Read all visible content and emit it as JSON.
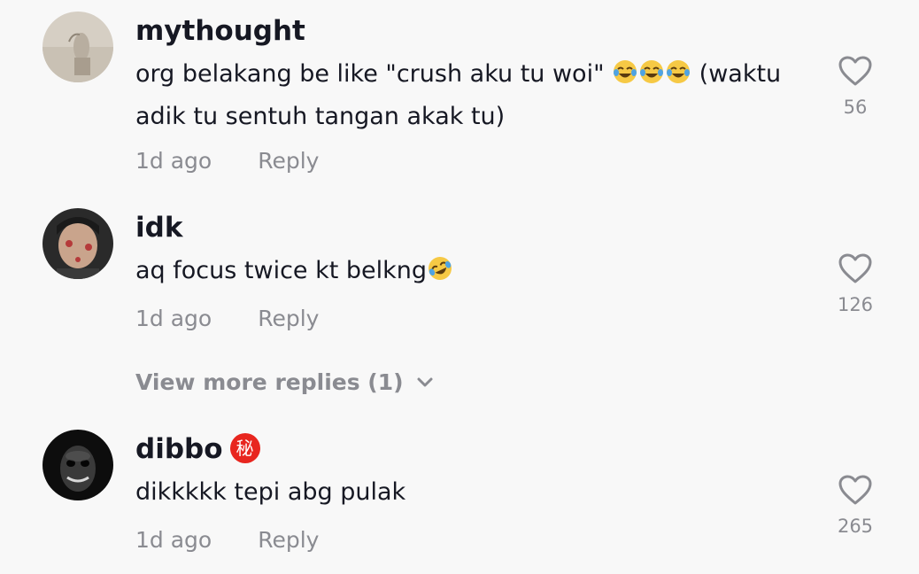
{
  "comments": [
    {
      "username": "mythought",
      "text_before": "org belakang be like \"crush aku tu woi\" ",
      "emoji_icons": [
        "face-with-tears-of-joy-icon",
        "face-with-tears-of-joy-icon",
        "face-with-tears-of-joy-icon"
      ],
      "text_after": " (waktu adik tu sentuh tangan akak tu)",
      "time": "1d ago",
      "reply_label": "Reply",
      "likes": "56"
    },
    {
      "username": "idk",
      "text_before": "aq focus twice kt belkng",
      "emoji_icons": [
        "rolling-on-floor-laughing-icon"
      ],
      "text_after": "",
      "time": "1d ago",
      "reply_label": "Reply",
      "likes": "126"
    },
    {
      "username": "dibbo",
      "badge": "秘",
      "text_before": "dikkkkk tepi abg pulak",
      "emoji_icons": [],
      "text_after": "",
      "time": "1d ago",
      "reply_label": "Reply",
      "likes": "265"
    }
  ],
  "view_more_label": "View more replies (1)",
  "colors": {
    "background": "#f8f8f8",
    "primary_text": "#161823",
    "secondary_text": "#8a8b91",
    "badge_red": "#e8261f"
  }
}
